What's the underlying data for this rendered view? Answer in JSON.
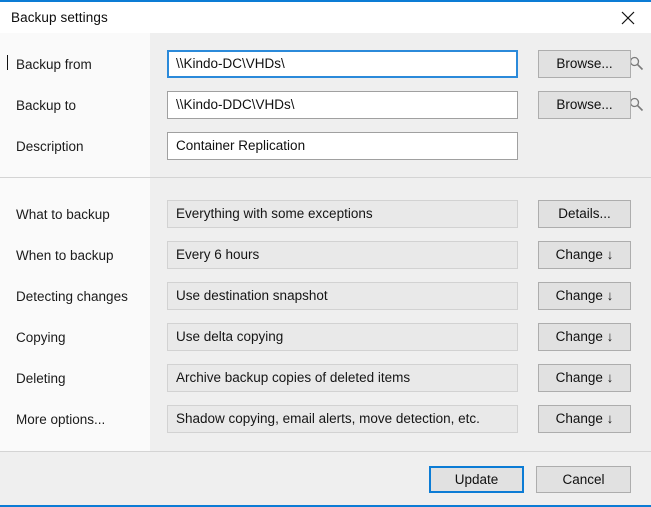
{
  "window": {
    "title": "Backup settings",
    "close_icon": "close-icon",
    "accent_color": "#0c7cd5",
    "panel_left_color": "#fafafa",
    "panel_right_color": "#efefef"
  },
  "top_section": {
    "rows": [
      {
        "label": "Backup from",
        "value": "\\\\Kindo-DC\\VHDs\\",
        "type": "text-input",
        "focused": true,
        "has_search_icon": true,
        "button": "Browse..."
      },
      {
        "label": "Backup to",
        "value": "\\\\Kindo-DDC\\VHDs\\",
        "type": "text-input",
        "focused": false,
        "has_search_icon": true,
        "button": "Browse..."
      },
      {
        "label": "Description",
        "value": "Container Replication",
        "type": "text-input",
        "focused": false,
        "has_search_icon": false,
        "button": ""
      }
    ]
  },
  "options_section": {
    "rows": [
      {
        "label": "What to backup",
        "value": "Everything with some exceptions",
        "button": "Details..."
      },
      {
        "label": "When to backup",
        "value": "Every 6 hours",
        "button": "Change ↓"
      },
      {
        "label": "Detecting changes",
        "value": "Use destination snapshot",
        "button": "Change ↓"
      },
      {
        "label": "Copying",
        "value": "Use delta copying",
        "button": "Change ↓"
      },
      {
        "label": "Deleting",
        "value": "Archive backup copies of deleted items",
        "button": "Change ↓"
      },
      {
        "label": "More options...",
        "value": "Shadow copying, email alerts, move detection, etc.",
        "button": "Change ↓"
      }
    ]
  },
  "footer": {
    "update_label": "Update",
    "cancel_label": "Cancel"
  }
}
